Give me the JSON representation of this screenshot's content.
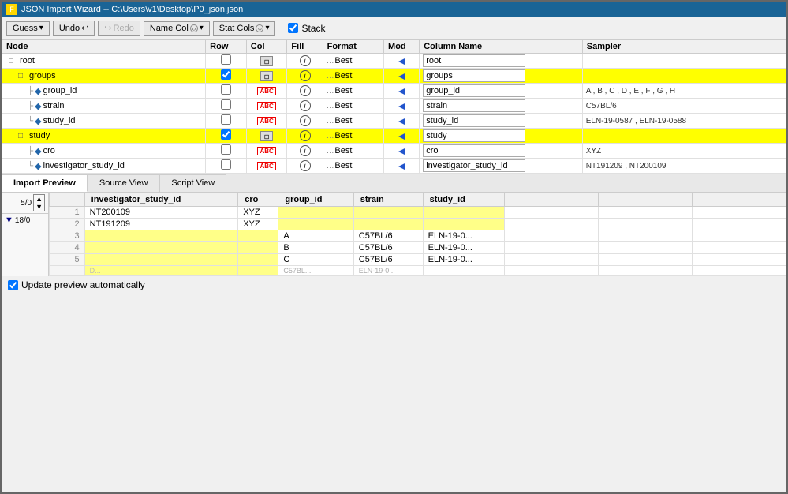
{
  "window": {
    "title": "JSON Import Wizard -- C:\\Users\\v1\\Desktop\\P0_json.json",
    "icon": "F"
  },
  "toolbar": {
    "guess_label": "Guess",
    "undo_label": "Undo",
    "redo_label": "Redo",
    "name_col_label": "Name Col",
    "stat_cols_label": "Stat Cols",
    "stack_label": "Stack",
    "stack_checked": true
  },
  "tree": {
    "headers": [
      "Node",
      "Row",
      "Col",
      "Fill",
      "Format",
      "Mod",
      "Column Name",
      "Sampler"
    ],
    "rows": [
      {
        "indent": 0,
        "expand": "□",
        "type": "expand",
        "label": "root",
        "row_check": false,
        "col_icon": "img",
        "fill_icon": "i",
        "format": "Best",
        "mod_arrow": true,
        "col_name": "root",
        "sampler": "",
        "highlight": false,
        "prefix": "□"
      },
      {
        "indent": 1,
        "expand": "□",
        "type": "expand",
        "label": "groups",
        "row_check": true,
        "col_icon": "img",
        "fill_icon": "i",
        "format": "Best",
        "mod_arrow": true,
        "col_name": "groups",
        "sampler": "",
        "highlight": true,
        "prefix": "□"
      },
      {
        "indent": 2,
        "type": "diamond",
        "label": "group_id",
        "row_check": false,
        "col_icon": "abc",
        "fill_icon": "i",
        "format": "Best",
        "mod_arrow": true,
        "col_name": "group_id",
        "sampler": "A , B , C , D , E , F , G , H",
        "highlight": false
      },
      {
        "indent": 2,
        "type": "diamond",
        "label": "strain",
        "row_check": false,
        "col_icon": "abc",
        "fill_icon": "i",
        "format": "Best",
        "mod_arrow": true,
        "col_name": "strain",
        "sampler": "C57BL/6",
        "highlight": false
      },
      {
        "indent": 2,
        "type": "diamond",
        "label": "study_id",
        "row_check": false,
        "col_icon": "abc",
        "fill_icon": "i",
        "format": "Best",
        "mod_arrow": true,
        "col_name": "study_id",
        "sampler": "ELN-19-0587 , ELN-19-0588",
        "highlight": false,
        "last_child": true
      },
      {
        "indent": 1,
        "expand": "□",
        "type": "expand",
        "label": "study",
        "row_check": true,
        "col_icon": "img",
        "fill_icon": "i",
        "format": "Best",
        "mod_arrow": true,
        "col_name": "study",
        "sampler": "",
        "highlight": true,
        "prefix": "□"
      },
      {
        "indent": 2,
        "type": "diamond",
        "label": "cro",
        "row_check": false,
        "col_icon": "abc",
        "fill_icon": "i",
        "format": "Best",
        "mod_arrow": true,
        "col_name": "cro",
        "sampler": "XYZ",
        "highlight": false
      },
      {
        "indent": 2,
        "type": "diamond",
        "label": "investigator_study_id",
        "row_check": false,
        "col_icon": "abc",
        "fill_icon": "i",
        "format": "Best",
        "mod_arrow": true,
        "col_name": "investigator_study_id",
        "sampler": "NT191209 , NT200109",
        "highlight": false,
        "last_child": true
      }
    ]
  },
  "preview": {
    "tabs": [
      "Import Preview",
      "Source View",
      "Script View"
    ],
    "active_tab": "Import Preview",
    "row_counter_top": "5/0",
    "row_group_label": "18/0",
    "columns": [
      "investigator_study_id",
      "cro",
      "group_id",
      "strain",
      "study_id"
    ],
    "rows": [
      {
        "num": "1",
        "investigator_study_id": "NT200109",
        "cro": "XYZ",
        "group_id": "",
        "strain": "",
        "study_id": "",
        "highlight": false
      },
      {
        "num": "2",
        "investigator_study_id": "NT191209",
        "cro": "XYZ",
        "group_id": "",
        "strain": "",
        "study_id": "",
        "highlight": false
      },
      {
        "num": "3",
        "investigator_study_id": "",
        "cro": "",
        "group_id": "A",
        "strain": "C57BL/6",
        "study_id": "ELN-19-0...",
        "highlight": false
      },
      {
        "num": "4",
        "investigator_study_id": "",
        "cro": "",
        "group_id": "B",
        "strain": "C57BL/6",
        "study_id": "ELN-19-0...",
        "highlight": false
      },
      {
        "num": "5",
        "investigator_study_id": "",
        "cro": "",
        "group_id": "C",
        "strain": "C57BL/6",
        "study_id": "ELN-19-0...",
        "highlight": false
      }
    ]
  },
  "footer": {
    "update_label": "Update preview automatically",
    "checked": true
  }
}
